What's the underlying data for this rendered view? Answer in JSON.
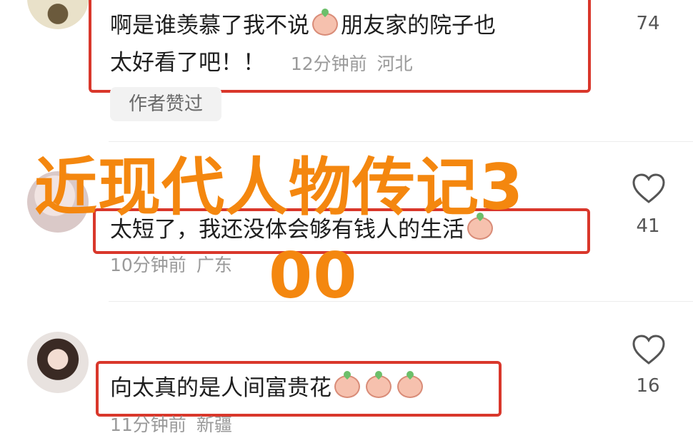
{
  "comments": [
    {
      "text_line1a": "啊是谁羡慕了我不说",
      "text_line1b": "朋友家的院子也",
      "text_line2": "太好看了吧！！",
      "time": "12分钟前",
      "location": "河北",
      "badge": "作者赞过",
      "likes": "74"
    },
    {
      "text": "太短了，我还没体会够有钱人的生活",
      "time": "10分钟前",
      "location": "广东",
      "likes": "41"
    },
    {
      "text": "向太真的是人间富贵花",
      "time": "11分钟前",
      "location": "新疆",
      "likes": "16"
    }
  ],
  "watermark": {
    "line1": "近现代人物传记3",
    "line2": "00"
  },
  "icons": {
    "heart": "heart-outline-icon",
    "emoji": "peach-face-emoji-icon"
  },
  "colors": {
    "highlight_box": "#d9372b",
    "watermark": "#f4870f",
    "meta_text": "#9a9a9a"
  }
}
